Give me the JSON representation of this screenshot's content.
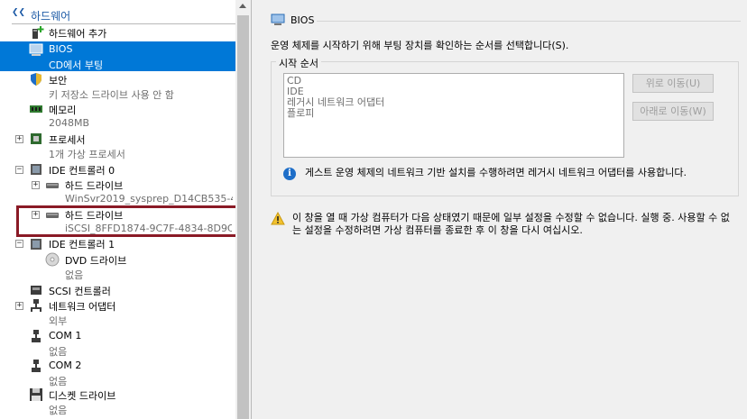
{
  "tree": {
    "header": "하드웨어",
    "items": [
      {
        "title": "하드웨어 추가",
        "sub": ""
      },
      {
        "title": "BIOS",
        "sub": "CD에서 부팅"
      },
      {
        "title": "보안",
        "sub": "키 저장소 드라이브 사용 안 함"
      },
      {
        "title": "메모리",
        "sub": "2048MB"
      },
      {
        "title": "프로세서",
        "sub": "1개 가상 프로세서"
      },
      {
        "title": "IDE 컨트롤러 0",
        "sub": ""
      },
      {
        "title": "하드 드라이브",
        "sub": "WinSvr2019_sysprep_D14CB535-4..."
      },
      {
        "title": "하드 드라이브",
        "sub": "iSCSI_8FFD1874-9C7F-4834-8D9C..."
      },
      {
        "title": "IDE 컨트롤러 1",
        "sub": ""
      },
      {
        "title": "DVD 드라이브",
        "sub": "없음"
      },
      {
        "title": "SCSI 컨트롤러",
        "sub": ""
      },
      {
        "title": "네트워크 어댑터",
        "sub": "외부"
      },
      {
        "title": "COM 1",
        "sub": "없음"
      },
      {
        "title": "COM 2",
        "sub": "없음"
      },
      {
        "title": "디스켓 드라이브",
        "sub": "없음"
      }
    ]
  },
  "bios": {
    "title": "BIOS",
    "description": "운영 체제를 시작하기 위해 부팅 장치를 확인하는 순서를 선택합니다(S).",
    "group_label": "시작 순서",
    "boot_order": [
      "CD",
      "IDE",
      "레거시 네트워크 어댑터",
      "플로피"
    ],
    "move_up": "위로 이동(U)",
    "move_down": "아래로 이동(W)",
    "info": "게스트 운영 체제의 네트워크 기반 설치를 수행하려면 레거시 네트워크 어댑터를 사용합니다.",
    "warning": "이 창을 열 때 가상 컴퓨터가 다음 상태였기 때문에 일부 설정을 수정할 수 없습니다. 실행 중. 사용할 수 없는 설정을 수정하려면 가상 컴퓨터를 종료한 후 이 창을 다시 여십시오."
  },
  "colors": {
    "selection": "#0078d7",
    "highlight_border": "#8a1a26",
    "header_text": "#1c5aa6"
  }
}
